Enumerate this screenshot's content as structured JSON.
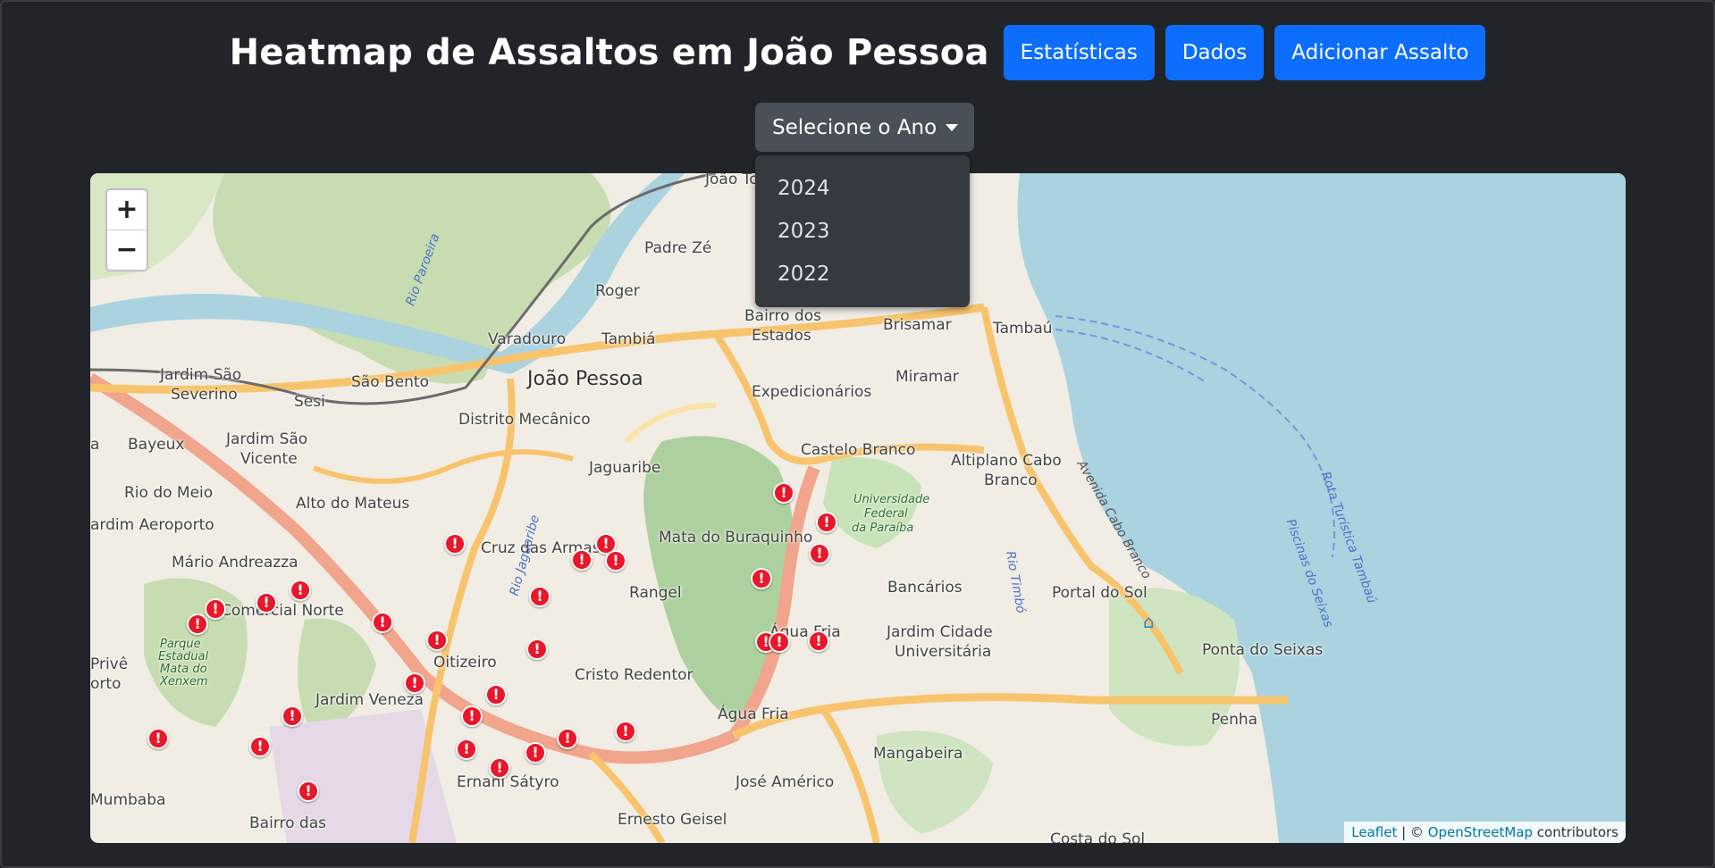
{
  "header": {
    "title": "Heatmap de Assaltos em João Pessoa",
    "buttons": {
      "statistics": "Estatísticas",
      "data": "Dados",
      "add": "Adicionar Assalto"
    }
  },
  "year_select": {
    "label": "Selecione o Ano",
    "options": [
      "2024",
      "2023",
      "2022"
    ]
  },
  "map": {
    "zoom_in": "+",
    "zoom_out": "−",
    "attribution": {
      "leaflet": "Leaflet",
      "separator": " | © ",
      "osm": "OpenStreetMap",
      "suffix": " contributors"
    },
    "marker_glyph": "!",
    "marker_color": "#e8172a",
    "places": [
      "João Tc",
      "Padre Zé",
      "Roger",
      "Varadouro",
      "Tambiá",
      "João Pessoa",
      "Bairro dos",
      "Estados",
      "Brisamar",
      "Tambaú",
      "Miramar",
      "Expedicionários",
      "Jardim São",
      "Severino",
      "São Bento",
      "Sesi",
      "Distrito Mecânico",
      "Bayeux",
      "Jardim São",
      "Vicente",
      "Castelo Branco",
      "Altiplano Cabo",
      "Branco",
      "Jaguaribe",
      "Rio do Meio",
      "Alto do Mateus",
      "ardim Aeroporto",
      "Mata do Buraquinho",
      "Cruz das Armas",
      "Mário Andreazza",
      "Rangel",
      "Bancários",
      "Portal do Sol",
      "Comercial Norte",
      "Água Fria",
      "Jardim Cidade",
      "Universitária",
      "Ponta do Seixas",
      "Oitizeiro",
      "Cristo Redentor",
      "Privê",
      "orto",
      "Jardim Veneza",
      "Água Fria",
      "Penha",
      "Mangabeira",
      "Ernani Sátyro",
      "José Américo",
      "Mumbaba",
      "Bairro das",
      "Ernesto Geisel",
      "Costa do Sol",
      "Universidade",
      "Federal",
      "da Paraíba",
      "Parque",
      "Estadual",
      "Mata do",
      "Xenxem",
      "Rio Paroeira",
      "Rio Jaguaribe",
      "Rio Timbó",
      "Avenida Cabo Branco",
      "Rota Turística Tambaú",
      "Piscinas do Seixas",
      "a"
    ]
  }
}
